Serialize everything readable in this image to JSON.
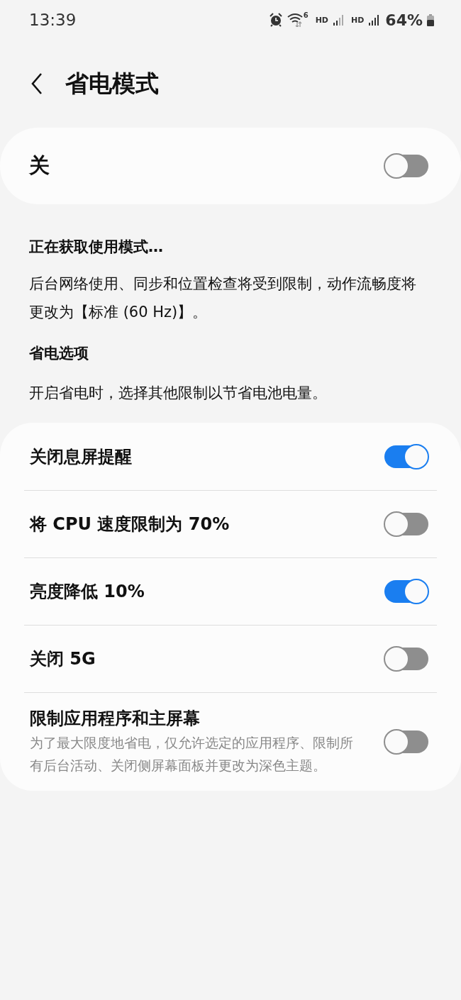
{
  "status_bar": {
    "time": "13:39",
    "wifi_badge": "6",
    "network_labels": [
      "HD",
      "HD"
    ],
    "battery": "64%"
  },
  "header": {
    "title": "省电模式"
  },
  "master": {
    "label": "关",
    "on": false
  },
  "mode_status": "正在获取使用模式…",
  "mode_description": "后台网络使用、同步和位置检查将受到限制，动作流畅度将更改为【标准 (60 Hz)】。",
  "options_section": {
    "title": "省电选项",
    "description": "开启省电时，选择其他限制以节省电池电量。"
  },
  "options": [
    {
      "label": "关闭息屏提醒",
      "on": true
    },
    {
      "label": "将 CPU 速度限制为 70%",
      "on": false
    },
    {
      "label": "亮度降低 10%",
      "on": true
    },
    {
      "label": "关闭 5G",
      "on": false
    },
    {
      "label": "限制应用程序和主屏幕",
      "description": "为了最大限度地省电，仅允许选定的应用程序、限制所有后台活动、关闭侧屏幕面板并更改为深色主题。",
      "on": false
    }
  ]
}
